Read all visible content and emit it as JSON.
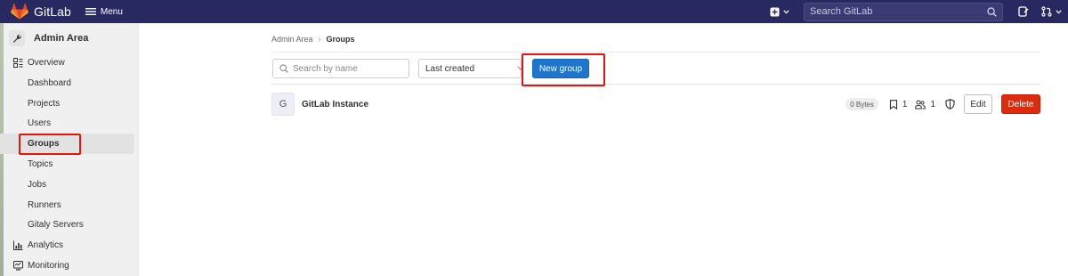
{
  "topbar": {
    "brand": "GitLab",
    "menu_label": "Menu",
    "search_placeholder": "Search GitLab",
    "background_color": "#292961",
    "logo_color": "#fc6d26"
  },
  "sidebar": {
    "context_title": "Admin Area",
    "items": [
      {
        "label": "Overview",
        "type": "section",
        "icon": "overview-icon"
      },
      {
        "label": "Dashboard",
        "type": "sub"
      },
      {
        "label": "Projects",
        "type": "sub"
      },
      {
        "label": "Users",
        "type": "sub"
      },
      {
        "label": "Groups",
        "type": "sub",
        "active": true
      },
      {
        "label": "Topics",
        "type": "sub"
      },
      {
        "label": "Jobs",
        "type": "sub"
      },
      {
        "label": "Runners",
        "type": "sub"
      },
      {
        "label": "Gitaly Servers",
        "type": "sub"
      },
      {
        "label": "Analytics",
        "type": "section",
        "icon": "chart-icon"
      },
      {
        "label": "Monitoring",
        "type": "section",
        "icon": "monitor-icon"
      }
    ]
  },
  "breadcrumb": {
    "parent": "Admin Area",
    "current": "Groups"
  },
  "filter": {
    "search_placeholder": "Search by name",
    "sort_selected": "Last created",
    "new_group_label": "New group",
    "new_group_color": "#1f75cb"
  },
  "groups": [
    {
      "avatar_letter": "G",
      "name": "GitLab Instance",
      "size": "0 Bytes",
      "projects_count": "1",
      "members_count": "1",
      "edit_label": "Edit",
      "delete_label": "Delete",
      "delete_color": "#dd2b0e"
    }
  ],
  "highlight_color": "#e8140c"
}
